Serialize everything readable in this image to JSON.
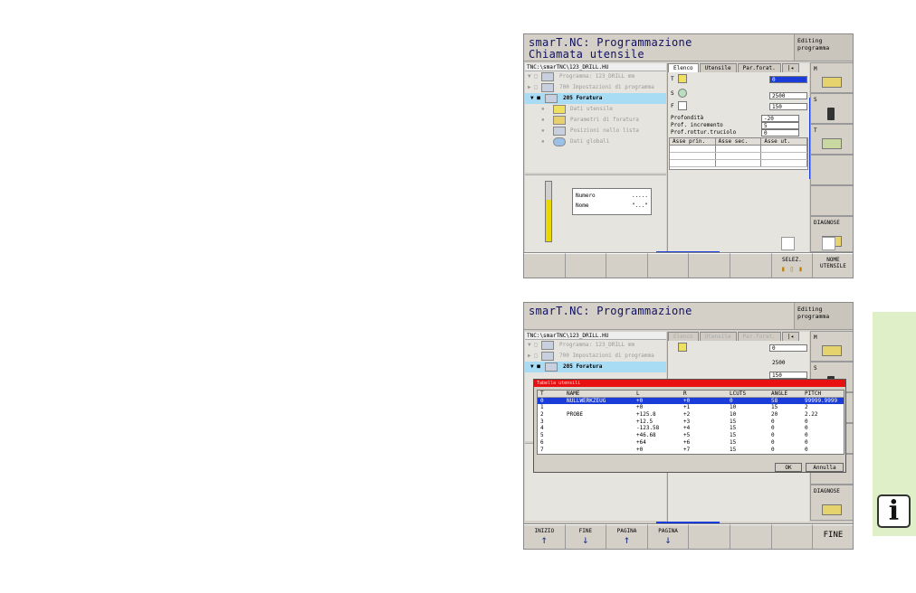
{
  "screen1": {
    "title_line1": "smarT.NC: Programmazione",
    "title_line2": "Chiamata utensile",
    "mode": [
      "Editing",
      "programma"
    ],
    "path": "TNC:\\smarTNC\\123_DRILL.HU",
    "tree": [
      {
        "label": "Programma: 123_DRILL mm",
        "toggle": "▼ □",
        "selected": false
      },
      {
        "label": "700 Impostazioni di programma",
        "toggle": "▶ □",
        "selected": false
      },
      {
        "label": "205 Foratura",
        "toggle": "▼ ■",
        "selected": true
      },
      {
        "label": "Dati utensile",
        "toggle": "▪",
        "selected": false
      },
      {
        "label": "Parametri di foratura",
        "toggle": "▪",
        "selected": false
      },
      {
        "label": "Posizioni nello lista",
        "toggle": "▪",
        "selected": false
      },
      {
        "label": "Dati globali",
        "toggle": "▪",
        "selected": false
      }
    ],
    "preview": {
      "numero_label": "Numero",
      "numero_value": ".....",
      "nome_label": "Nome",
      "nome_value": "\"...\""
    },
    "tabs": [
      "Elenco",
      "Utensile",
      "Par.forat.",
      "|◂"
    ],
    "fields": [
      {
        "label": "T",
        "value": "0"
      },
      {
        "label": "S",
        "value": "2500"
      },
      {
        "label": "F",
        "value": "150"
      },
      {
        "label": "Profondità",
        "value": "-20"
      },
      {
        "label": "Prof. incremento",
        "value": "5"
      },
      {
        "label": "Prof.rottur.truciolo",
        "value": "0"
      }
    ],
    "axis_headers": [
      "Asse prin.",
      "Asse sec.",
      "Asse ut."
    ],
    "sidebar": [
      "M",
      "S",
      "T",
      "",
      "",
      "DIAGNOSE",
      "",
      "NOME UTENSILE"
    ],
    "softkeys": [
      "",
      "",
      "",
      "",
      "",
      "",
      "SELEZ.",
      "NOME\nUTENSILE"
    ]
  },
  "screen2": {
    "title_line1": "smarT.NC: Programmazione",
    "mode": [
      "Editing",
      "programma"
    ],
    "path": "TNC:\\smarTNC\\123_DRILL.HU",
    "tree": [
      {
        "label": "Programma: 123_DRILL mm",
        "toggle": "▼ □"
      },
      {
        "label": "700 Impostazioni di programma",
        "toggle": "▶ □"
      },
      {
        "label": "205 Foratura",
        "toggle": "▼ ■"
      }
    ],
    "tabs": [
      "Elenco",
      "Utensile",
      "Par.forat.",
      "|◂"
    ],
    "fields": [
      {
        "value": "0"
      },
      {
        "value": "2500"
      },
      {
        "value": "150"
      }
    ],
    "dialog_title": "Tabella utensili",
    "table_headers": [
      "T",
      "NAME",
      "L",
      "R",
      "LCUTS",
      "ANGLE",
      "PITCH"
    ],
    "table_rows": [
      [
        "0",
        "NULLWERKZEUG",
        "+0",
        "+0",
        "0",
        "58",
        "99999.9999"
      ],
      [
        "1",
        "",
        "+0",
        "+1",
        "10",
        "15",
        "2"
      ],
      [
        "2",
        "PROBE",
        "+125.8",
        "+2",
        "10",
        "20",
        "2.22"
      ],
      [
        "3",
        "",
        "+12.5",
        "+3",
        "15",
        "0",
        "0"
      ],
      [
        "4",
        "",
        "-123.58",
        "+4",
        "15",
        "0",
        "0"
      ],
      [
        "5",
        "",
        "+46.68",
        "+5",
        "15",
        "0",
        "0"
      ],
      [
        "6",
        "",
        "+64",
        "+6",
        "15",
        "0",
        "0"
      ],
      [
        "7",
        "",
        "+0",
        "+7",
        "15",
        "0",
        "0"
      ]
    ],
    "ok_label": "OK",
    "cancel_label": "Annulla",
    "sidebar": [
      "M",
      "S",
      "",
      "",
      "DIAGNOSE",
      ""
    ],
    "softkeys": [
      "INIZIO",
      "FINE",
      "PAGINA",
      "PAGINA",
      "",
      "",
      "",
      "FINE"
    ]
  },
  "info_icon": "i",
  "colors": {
    "highlight": "#1a3cd8",
    "selection": "#a8dcf4",
    "dialog_title": "#e81010",
    "info_panel": "#dff0c8"
  }
}
